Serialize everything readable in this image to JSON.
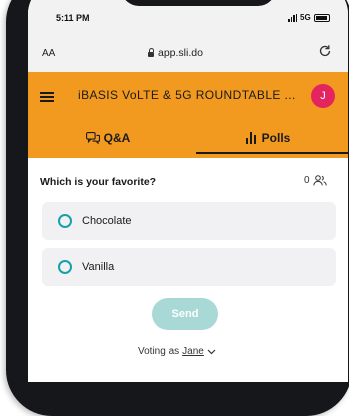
{
  "status_bar": {
    "time": "5:11 PM",
    "network": "5G"
  },
  "browser": {
    "aa_label": "AA",
    "url": "app.sli.do"
  },
  "header": {
    "event_title": "iBASIS VoLTE & 5G ROUNDTABLE ...",
    "avatar_initial": "J"
  },
  "tabs": [
    {
      "label": "Q&A",
      "active": false
    },
    {
      "label": "Polls",
      "active": true
    }
  ],
  "poll": {
    "question": "Which is your favorite?",
    "participant_count": "0",
    "options": [
      {
        "label": "Chocolate"
      },
      {
        "label": "Vanilla"
      }
    ],
    "send_label": "Send",
    "voting_as_prefix": "Voting as",
    "voter_name": "Jane"
  },
  "colors": {
    "header_bg": "#f29a1f",
    "avatar_bg": "#e3245f",
    "accent": "#18a0a8",
    "send_disabled": "#a8d9d6"
  }
}
